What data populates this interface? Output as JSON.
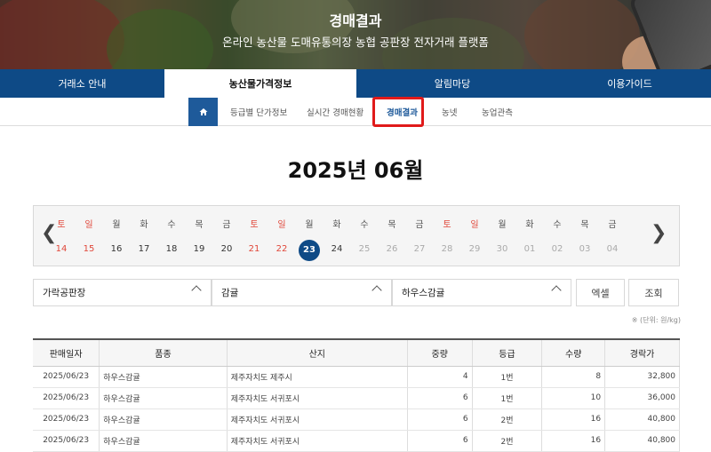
{
  "hero": {
    "title": "경매결과",
    "subtitle": "온라인 농산물 도매유통의장 농협 공판장 전자거래 플랫폼"
  },
  "main_nav": [
    {
      "label": "거래소 안내",
      "active": false
    },
    {
      "label": "농산물가격정보",
      "active": true
    },
    {
      "label": "알림마당",
      "active": false
    },
    {
      "label": "이용가이드",
      "active": false
    }
  ],
  "sub_nav": {
    "home_icon": "home-icon",
    "items": [
      {
        "label": "등급별 단가정보",
        "active": false
      },
      {
        "label": "실시간 경매현황",
        "active": false
      },
      {
        "label": "경매결과",
        "active": true
      },
      {
        "label": "농넷",
        "active": false
      },
      {
        "label": "농업관측",
        "active": false
      }
    ]
  },
  "month_title": "2025년 06월",
  "calendar": {
    "prev_icon": "chevron-left-icon",
    "next_icon": "chevron-right-icon",
    "days": [
      {
        "wd": "토",
        "d": "14",
        "weekend": true,
        "state": "past"
      },
      {
        "wd": "일",
        "d": "15",
        "weekend": true,
        "state": "past"
      },
      {
        "wd": "월",
        "d": "16",
        "weekend": false,
        "state": "past"
      },
      {
        "wd": "화",
        "d": "17",
        "weekend": false,
        "state": "past"
      },
      {
        "wd": "수",
        "d": "18",
        "weekend": false,
        "state": "past"
      },
      {
        "wd": "목",
        "d": "19",
        "weekend": false,
        "state": "past"
      },
      {
        "wd": "금",
        "d": "20",
        "weekend": false,
        "state": "past"
      },
      {
        "wd": "토",
        "d": "21",
        "weekend": true,
        "state": "past"
      },
      {
        "wd": "일",
        "d": "22",
        "weekend": true,
        "state": "past"
      },
      {
        "wd": "월",
        "d": "23",
        "weekend": false,
        "state": "selected"
      },
      {
        "wd": "화",
        "d": "24",
        "weekend": false,
        "state": "past"
      },
      {
        "wd": "수",
        "d": "25",
        "weekend": false,
        "state": "future"
      },
      {
        "wd": "목",
        "d": "26",
        "weekend": false,
        "state": "future"
      },
      {
        "wd": "금",
        "d": "27",
        "weekend": false,
        "state": "future"
      },
      {
        "wd": "토",
        "d": "28",
        "weekend": true,
        "state": "future"
      },
      {
        "wd": "일",
        "d": "29",
        "weekend": true,
        "state": "future"
      },
      {
        "wd": "월",
        "d": "30",
        "weekend": false,
        "state": "future"
      },
      {
        "wd": "화",
        "d": "01",
        "weekend": false,
        "state": "future"
      },
      {
        "wd": "수",
        "d": "02",
        "weekend": false,
        "state": "future"
      },
      {
        "wd": "목",
        "d": "03",
        "weekend": false,
        "state": "future"
      },
      {
        "wd": "금",
        "d": "04",
        "weekend": false,
        "state": "future"
      }
    ]
  },
  "filters": {
    "market": "가락공판장",
    "item": "감귤",
    "variety": "하우스감귤",
    "excel_label": "엑셀",
    "search_label": "조회",
    "unit_note": "※ (단위: 원/kg)"
  },
  "table": {
    "headers": [
      "판매일자",
      "품종",
      "산지",
      "중량",
      "등급",
      "수량",
      "경락가"
    ],
    "rows": [
      [
        "2025/06/23",
        "하우스감귤",
        "제주자치도 제주시",
        "4",
        "1번",
        "8",
        "32,800"
      ],
      [
        "2025/06/23",
        "하우스감귤",
        "제주자치도 서귀포시",
        "6",
        "1번",
        "10",
        "36,000"
      ],
      [
        "2025/06/23",
        "하우스감귤",
        "제주자치도 서귀포시",
        "6",
        "2번",
        "16",
        "40,800"
      ],
      [
        "2025/06/23",
        "하우스감귤",
        "제주자치도 서귀포시",
        "6",
        "2번",
        "16",
        "40,800"
      ]
    ]
  },
  "colors": {
    "nav_blue": "#0e4a86",
    "highlight_red": "#e01a1a",
    "weekend_red": "#e0473a"
  }
}
